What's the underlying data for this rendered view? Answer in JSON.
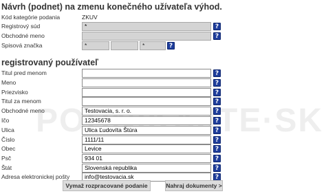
{
  "header": {
    "title": "Návrh (podnet) na zmenu konečného užívateľa výhod."
  },
  "top_fields": {
    "kod_label": "Kód kategórie podania",
    "kod_value": "ZKUV",
    "registrovy_sud_label": "Registrový súd",
    "registrovy_sud_value": "*",
    "obchodne_meno_label": "Obchodné meno",
    "obchodne_meno_value": "",
    "spisova_znacka_label": "Spisová značka",
    "spisova_znacka_values": [
      "*",
      "",
      "*"
    ]
  },
  "section": {
    "title": "registrovaný používateľ"
  },
  "user_fields": [
    {
      "label": "Titul pred menom",
      "value": ""
    },
    {
      "label": "Meno",
      "value": ""
    },
    {
      "label": "Priezvisko",
      "value": ""
    },
    {
      "label": "Titul za menom",
      "value": ""
    },
    {
      "label": "Obchodné meno",
      "value": "Testovacia, s. r. o."
    },
    {
      "label": "Ičo",
      "value": "12345678"
    },
    {
      "label": "Ulica",
      "value": "Ulica Ľudovíta Štúra"
    },
    {
      "label": "Číslo",
      "value": "1111/11"
    },
    {
      "label": "Obec",
      "value": "Levice"
    },
    {
      "label": "Psč",
      "value": "934 01"
    },
    {
      "label": "Štát",
      "value": "Slovenská republika"
    },
    {
      "label": "Adresa elektronickej pošty",
      "value": "info@testovacia.sk"
    }
  ],
  "help_glyph": "?",
  "watermark": "POHNIKAJTE·SK",
  "buttons": {
    "reset": "Vymaž rozpracované podanie",
    "upload": "Nahraj dokumenty >"
  },
  "colors": {
    "help_bg": "#1f3e9c",
    "disabled_field_bg": "#d4d4d4",
    "button_bg": "#dcdcdc"
  }
}
